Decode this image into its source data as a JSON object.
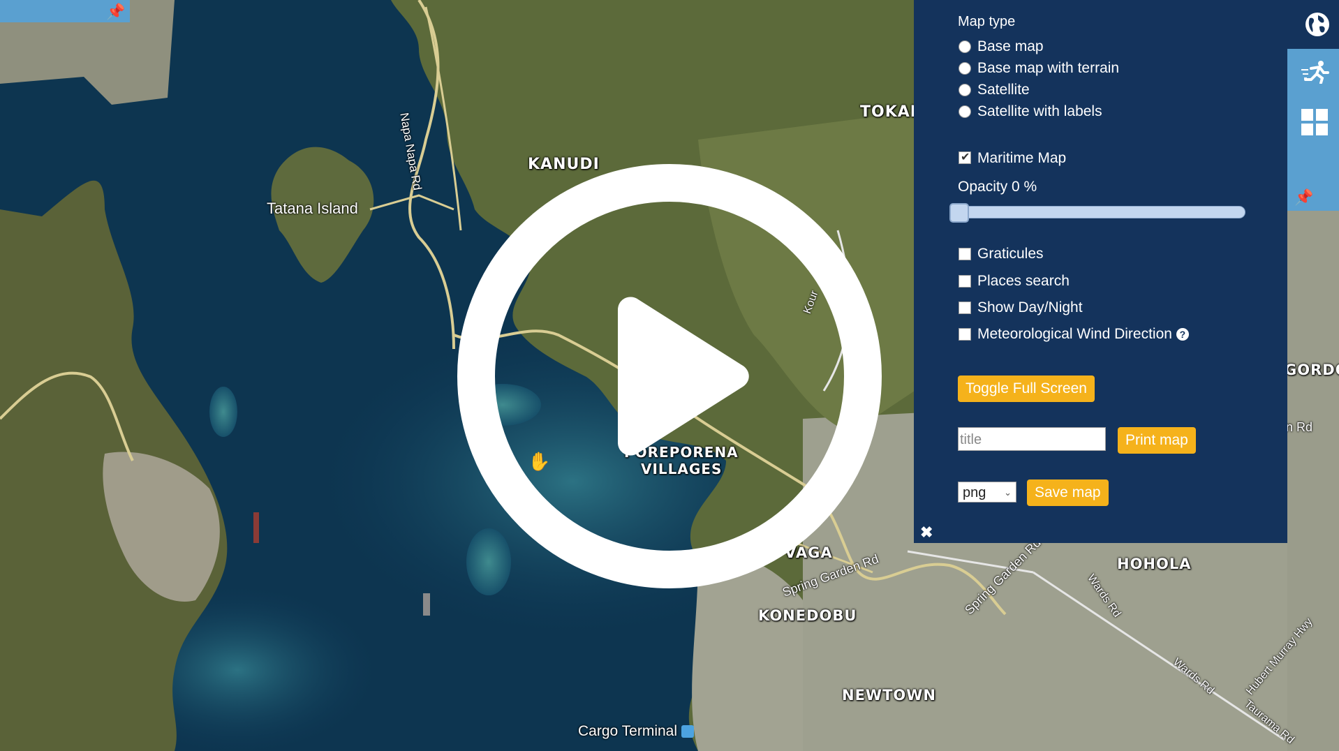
{
  "map": {
    "places": [
      {
        "key": "kanudi",
        "label": "KANUDI"
      },
      {
        "key": "tokara",
        "label": "TOKAF"
      },
      {
        "key": "tatana",
        "label": "Tatana Island"
      },
      {
        "key": "poreporena1",
        "label": "POREPORENA"
      },
      {
        "key": "poreporena2",
        "label": "VILLAGES"
      },
      {
        "key": "hohola",
        "label": "HOHOLA"
      },
      {
        "key": "konedobu",
        "label": "KONEDOBU"
      },
      {
        "key": "newtown",
        "label": "NEWTOWN"
      },
      {
        "key": "gordons",
        "label": "GORDO"
      },
      {
        "key": "vaga",
        "label": "VAGA"
      },
      {
        "key": "cargo",
        "label": "Cargo Terminal"
      }
    ],
    "roads": [
      {
        "label": "Napa Napa Rd"
      },
      {
        "label": "Spring Garden Rd"
      },
      {
        "label": "Spring Garden Rd"
      },
      {
        "label": "Wards Rd"
      },
      {
        "label": "Wards Rd"
      },
      {
        "label": "Hubert Murray Hwy"
      },
      {
        "label": "Taurama Rd"
      },
      {
        "label": "n Rd"
      },
      {
        "label": "Kour"
      }
    ],
    "colors": {
      "water": "#0d3550",
      "land": "#5f6b3c",
      "urban": "#a3a293"
    }
  },
  "panel": {
    "map_type_title": "Map type",
    "map_types": [
      {
        "label": "Base map",
        "selected": false
      },
      {
        "label": "Base map with terrain",
        "selected": false
      },
      {
        "label": "Satellite",
        "selected": false
      },
      {
        "label": "Satellite with labels",
        "selected": false
      }
    ],
    "maritime_label": "Maritime Map",
    "maritime_checked": true,
    "opacity_label": "Opacity 0 %",
    "opacity_value": 0,
    "options": [
      {
        "label": "Graticules",
        "checked": false
      },
      {
        "label": "Places search",
        "checked": false
      },
      {
        "label": "Show Day/Night",
        "checked": false
      },
      {
        "label": "Meteorological Wind Direction",
        "checked": false
      }
    ],
    "fullscreen_label": "Toggle Full Screen",
    "title_placeholder": "title",
    "print_label": "Print map",
    "format_value": "png",
    "save_label": "Save map",
    "colors": {
      "background": "#14335c",
      "button": "#f5b21b",
      "strip": "#5aa0d0"
    }
  },
  "toolbar": {
    "icons": [
      "globe-icon",
      "running-person-icon",
      "grid-icon",
      "pin-icon"
    ]
  }
}
